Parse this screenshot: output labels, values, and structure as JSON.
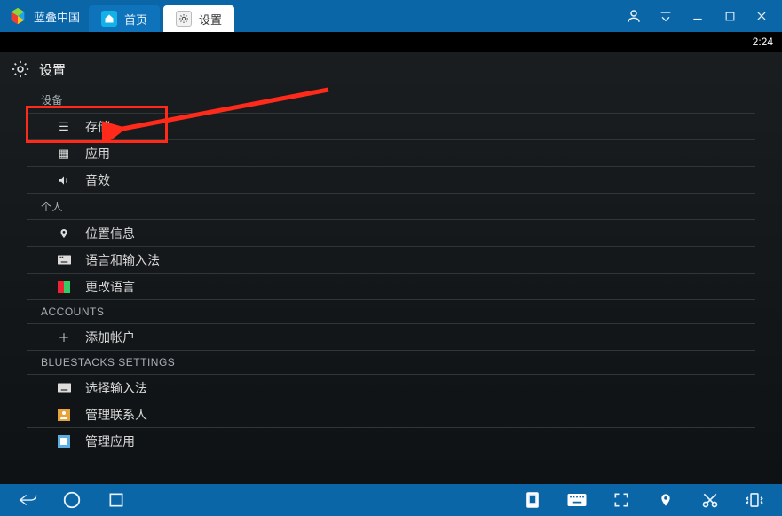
{
  "titlebar": {
    "brand": "蓝叠中国",
    "tabs": [
      {
        "label": "首页"
      },
      {
        "label": "设置"
      }
    ]
  },
  "statusbar": {
    "time": "2:24"
  },
  "settings": {
    "title": "设置",
    "sections": [
      {
        "header": "设备",
        "items": [
          {
            "label": "存储",
            "icon": "storage"
          },
          {
            "label": "应用",
            "icon": "apps"
          },
          {
            "label": "音效",
            "icon": "sound"
          }
        ]
      },
      {
        "header": "个人",
        "items": [
          {
            "label": "位置信息",
            "icon": "location"
          },
          {
            "label": "语言和输入法",
            "icon": "keyboard"
          },
          {
            "label": "更改语言",
            "icon": "language"
          }
        ]
      },
      {
        "header": "ACCOUNTS",
        "items": [
          {
            "label": "添加帐户",
            "icon": "plus"
          }
        ]
      },
      {
        "header": "BLUESTACKS SETTINGS",
        "items": [
          {
            "label": "选择输入法",
            "icon": "keyboard2"
          },
          {
            "label": "管理联系人",
            "icon": "contacts"
          },
          {
            "label": "管理应用",
            "icon": "manage"
          }
        ]
      }
    ]
  }
}
